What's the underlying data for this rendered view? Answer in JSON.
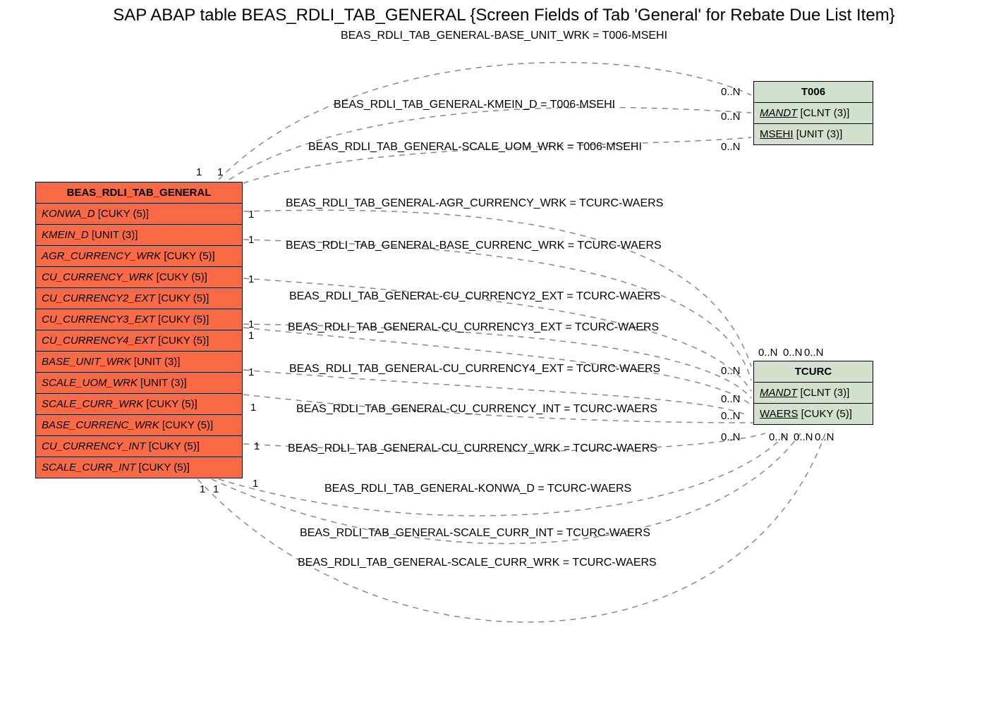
{
  "title": "SAP ABAP table BEAS_RDLI_TAB_GENERAL {Screen Fields of Tab 'General' for Rebate Due List Item}",
  "subtitle_rel": "BEAS_RDLI_TAB_GENERAL-BASE_UNIT_WRK = T006-MSEHI",
  "main_entity": {
    "name": "BEAS_RDLI_TAB_GENERAL",
    "fields": [
      {
        "name": "KONWA_D",
        "type": "[CUKY (5)]"
      },
      {
        "name": "KMEIN_D",
        "type": "[UNIT (3)]"
      },
      {
        "name": "AGR_CURRENCY_WRK",
        "type": "[CUKY (5)]"
      },
      {
        "name": "CU_CURRENCY_WRK",
        "type": "[CUKY (5)]"
      },
      {
        "name": "CU_CURRENCY2_EXT",
        "type": "[CUKY (5)]"
      },
      {
        "name": "CU_CURRENCY3_EXT",
        "type": "[CUKY (5)]"
      },
      {
        "name": "CU_CURRENCY4_EXT",
        "type": "[CUKY (5)]"
      },
      {
        "name": "BASE_UNIT_WRK",
        "type": "[UNIT (3)]"
      },
      {
        "name": "SCALE_UOM_WRK",
        "type": "[UNIT (3)]"
      },
      {
        "name": "SCALE_CURR_WRK",
        "type": "[CUKY (5)]"
      },
      {
        "name": "BASE_CURRENC_WRK",
        "type": "[CUKY (5)]"
      },
      {
        "name": "CU_CURRENCY_INT",
        "type": "[CUKY (5)]"
      },
      {
        "name": "SCALE_CURR_INT",
        "type": "[CUKY (5)]"
      }
    ]
  },
  "t006": {
    "name": "T006",
    "fields": [
      {
        "name": "MANDT",
        "type": "[CLNT (3)]",
        "key": true,
        "italic": true
      },
      {
        "name": "MSEHI",
        "type": "[UNIT (3)]",
        "key": true,
        "italic": false
      }
    ]
  },
  "tcurc": {
    "name": "TCURC",
    "fields": [
      {
        "name": "MANDT",
        "type": "[CLNT (3)]",
        "key": true,
        "italic": true
      },
      {
        "name": "WAERS",
        "type": "[CUKY (5)]",
        "key": true,
        "italic": false
      }
    ]
  },
  "relations": [
    {
      "text": "BEAS_RDLI_TAB_GENERAL-KMEIN_D = T006-MSEHI"
    },
    {
      "text": "BEAS_RDLI_TAB_GENERAL-SCALE_UOM_WRK = T006-MSEHI"
    },
    {
      "text": "BEAS_RDLI_TAB_GENERAL-AGR_CURRENCY_WRK = TCURC-WAERS"
    },
    {
      "text": "BEAS_RDLI_TAB_GENERAL-BASE_CURRENC_WRK = TCURC-WAERS"
    },
    {
      "text": "BEAS_RDLI_TAB_GENERAL-CU_CURRENCY2_EXT = TCURC-WAERS"
    },
    {
      "text": "BEAS_RDLI_TAB_GENERAL-CU_CURRENCY3_EXT = TCURC-WAERS"
    },
    {
      "text": "BEAS_RDLI_TAB_GENERAL-CU_CURRENCY4_EXT = TCURC-WAERS"
    },
    {
      "text": "BEAS_RDLI_TAB_GENERAL-CU_CURRENCY_INT = TCURC-WAERS"
    },
    {
      "text": "BEAS_RDLI_TAB_GENERAL-CU_CURRENCY_WRK = TCURC-WAERS"
    },
    {
      "text": "BEAS_RDLI_TAB_GENERAL-KONWA_D = TCURC-WAERS"
    },
    {
      "text": "BEAS_RDLI_TAB_GENERAL-SCALE_CURR_INT = TCURC-WAERS"
    },
    {
      "text": "BEAS_RDLI_TAB_GENERAL-SCALE_CURR_WRK = TCURC-WAERS"
    }
  ],
  "cards_left": {
    "c1": "1",
    "c2": "1",
    "c3": "1",
    "c4": "1",
    "c5": "1",
    "c6": "1",
    "c7": "1",
    "c8": "1",
    "c9": "1",
    "c10": "1",
    "c11": "1",
    "c12": "1",
    "c13": "1"
  },
  "cards_right": {
    "t006a": "0..N",
    "t006b": "0..N",
    "t006c": "0..N",
    "tc1": "0..N",
    "tc2": "0..N",
    "tc3": "0..N",
    "tc4": "0..N",
    "tc5": "0..N",
    "tc6": "0..N",
    "tc7": "0..N",
    "tc8": "0..N",
    "tc9": "0..N",
    "tc10": "0..N"
  },
  "chart_data": {
    "type": "er-diagram",
    "entities": [
      {
        "name": "BEAS_RDLI_TAB_GENERAL",
        "description": "Screen Fields of Tab 'General' for Rebate Due List Item",
        "fields": [
          {
            "name": "KONWA_D",
            "datatype": "CUKY",
            "length": 5
          },
          {
            "name": "KMEIN_D",
            "datatype": "UNIT",
            "length": 3
          },
          {
            "name": "AGR_CURRENCY_WRK",
            "datatype": "CUKY",
            "length": 5
          },
          {
            "name": "CU_CURRENCY_WRK",
            "datatype": "CUKY",
            "length": 5
          },
          {
            "name": "CU_CURRENCY2_EXT",
            "datatype": "CUKY",
            "length": 5
          },
          {
            "name": "CU_CURRENCY3_EXT",
            "datatype": "CUKY",
            "length": 5
          },
          {
            "name": "CU_CURRENCY4_EXT",
            "datatype": "CUKY",
            "length": 5
          },
          {
            "name": "BASE_UNIT_WRK",
            "datatype": "UNIT",
            "length": 3
          },
          {
            "name": "SCALE_UOM_WRK",
            "datatype": "UNIT",
            "length": 3
          },
          {
            "name": "SCALE_CURR_WRK",
            "datatype": "CUKY",
            "length": 5
          },
          {
            "name": "BASE_CURRENC_WRK",
            "datatype": "CUKY",
            "length": 5
          },
          {
            "name": "CU_CURRENCY_INT",
            "datatype": "CUKY",
            "length": 5
          },
          {
            "name": "SCALE_CURR_INT",
            "datatype": "CUKY",
            "length": 5
          }
        ]
      },
      {
        "name": "T006",
        "fields": [
          {
            "name": "MANDT",
            "datatype": "CLNT",
            "length": 3,
            "key": true
          },
          {
            "name": "MSEHI",
            "datatype": "UNIT",
            "length": 3,
            "key": true
          }
        ]
      },
      {
        "name": "TCURC",
        "fields": [
          {
            "name": "MANDT",
            "datatype": "CLNT",
            "length": 3,
            "key": true
          },
          {
            "name": "WAERS",
            "datatype": "CUKY",
            "length": 5,
            "key": true
          }
        ]
      }
    ],
    "relationships": [
      {
        "from": "BEAS_RDLI_TAB_GENERAL.BASE_UNIT_WRK",
        "to": "T006.MSEHI",
        "from_card": "1",
        "to_card": "0..N"
      },
      {
        "from": "BEAS_RDLI_TAB_GENERAL.KMEIN_D",
        "to": "T006.MSEHI",
        "from_card": "1",
        "to_card": "0..N"
      },
      {
        "from": "BEAS_RDLI_TAB_GENERAL.SCALE_UOM_WRK",
        "to": "T006.MSEHI",
        "from_card": "1",
        "to_card": "0..N"
      },
      {
        "from": "BEAS_RDLI_TAB_GENERAL.AGR_CURRENCY_WRK",
        "to": "TCURC.WAERS",
        "from_card": "1",
        "to_card": "0..N"
      },
      {
        "from": "BEAS_RDLI_TAB_GENERAL.BASE_CURRENC_WRK",
        "to": "TCURC.WAERS",
        "from_card": "1",
        "to_card": "0..N"
      },
      {
        "from": "BEAS_RDLI_TAB_GENERAL.CU_CURRENCY2_EXT",
        "to": "TCURC.WAERS",
        "from_card": "1",
        "to_card": "0..N"
      },
      {
        "from": "BEAS_RDLI_TAB_GENERAL.CU_CURRENCY3_EXT",
        "to": "TCURC.WAERS",
        "from_card": "1",
        "to_card": "0..N"
      },
      {
        "from": "BEAS_RDLI_TAB_GENERAL.CU_CURRENCY4_EXT",
        "to": "TCURC.WAERS",
        "from_card": "1",
        "to_card": "0..N"
      },
      {
        "from": "BEAS_RDLI_TAB_GENERAL.CU_CURRENCY_INT",
        "to": "TCURC.WAERS",
        "from_card": "1",
        "to_card": "0..N"
      },
      {
        "from": "BEAS_RDLI_TAB_GENERAL.CU_CURRENCY_WRK",
        "to": "TCURC.WAERS",
        "from_card": "1",
        "to_card": "0..N"
      },
      {
        "from": "BEAS_RDLI_TAB_GENERAL.KONWA_D",
        "to": "TCURC.WAERS",
        "from_card": "1",
        "to_card": "0..N"
      },
      {
        "from": "BEAS_RDLI_TAB_GENERAL.SCALE_CURR_INT",
        "to": "TCURC.WAERS",
        "from_card": "1",
        "to_card": "0..N"
      },
      {
        "from": "BEAS_RDLI_TAB_GENERAL.SCALE_CURR_WRK",
        "to": "TCURC.WAERS",
        "from_card": "1",
        "to_card": "0..N"
      }
    ]
  }
}
